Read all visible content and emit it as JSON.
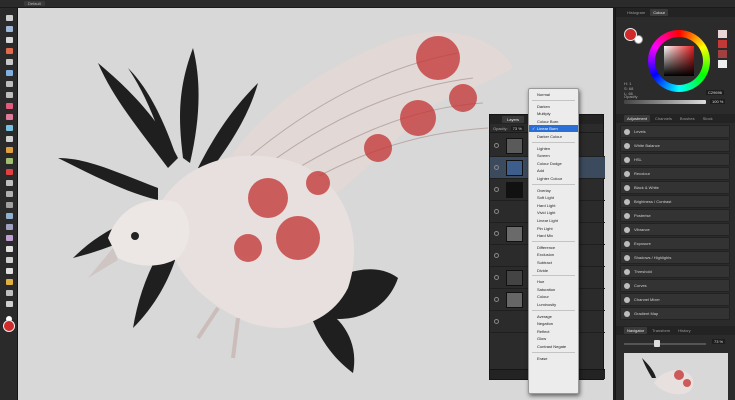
{
  "app": {
    "top_dropdown": "Default"
  },
  "toolbar": {
    "tools": [
      "move",
      "node",
      "crop",
      "paint-brush",
      "selection-brush",
      "flood-select",
      "marquee",
      "freehand-select",
      "erase-brush",
      "background-erase",
      "fill",
      "clone",
      "healing",
      "patch",
      "red-eye",
      "dodge",
      "burn",
      "sponge",
      "blur",
      "sharpen",
      "smudge",
      "pen",
      "shape",
      "text",
      "color-picker",
      "zoom",
      "view"
    ],
    "foreground_color": "#d12a2a",
    "background_color": "#ffffff"
  },
  "layers_panel": {
    "tab": "Layers",
    "opacity_label": "Opacity:",
    "opacity_value": "73 %"
  },
  "blend_modes": {
    "selected": "Linear Burn",
    "groups": [
      [
        "Normal"
      ],
      [
        "Darken",
        "Multiply",
        "Colour Burn",
        "Linear Burn",
        "Darker Colour"
      ],
      [
        "Lighten",
        "Screen",
        "Colour Dodge",
        "Add",
        "Lighter Colour"
      ],
      [
        "Overlay",
        "Soft Light",
        "Hard Light",
        "Vivid Light",
        "Linear Light",
        "Pin Light",
        "Hard Mix"
      ],
      [
        "Difference",
        "Exclusion",
        "Subtract",
        "Divide"
      ],
      [
        "Hue",
        "Saturation",
        "Colour",
        "Luminosity"
      ],
      [
        "Average",
        "Negation",
        "Reflect",
        "Glow",
        "Contrast Negate"
      ],
      [
        "Erase"
      ]
    ]
  },
  "color_panel": {
    "tabs": [
      "Histogram",
      "Colour"
    ],
    "active_tab": "Colour",
    "hsl": [
      "H: 1",
      "S: 68",
      "L: 66"
    ],
    "hex": "C29696",
    "opacity_label": "Opacity",
    "opacity_value": "100 %",
    "accent": "#e51c1c"
  },
  "adjustment_panel": {
    "tabs": [
      "Adjustment",
      "Channels",
      "Brushes",
      "Stock"
    ],
    "active_tab": "Adjustment",
    "items": [
      "Levels",
      "White Balance",
      "HSL",
      "Recolour",
      "Black & White",
      "Brightness / Contrast",
      "Posterise",
      "Vibrance",
      "Exposure",
      "Shadows / Highlights",
      "Threshold",
      "Curves",
      "Channel Mixer",
      "Gradient Map"
    ]
  },
  "navigator_panel": {
    "tabs": [
      "Navigator",
      "Transform",
      "History"
    ],
    "active_tab": "Navigator",
    "zoom": "73 %"
  }
}
